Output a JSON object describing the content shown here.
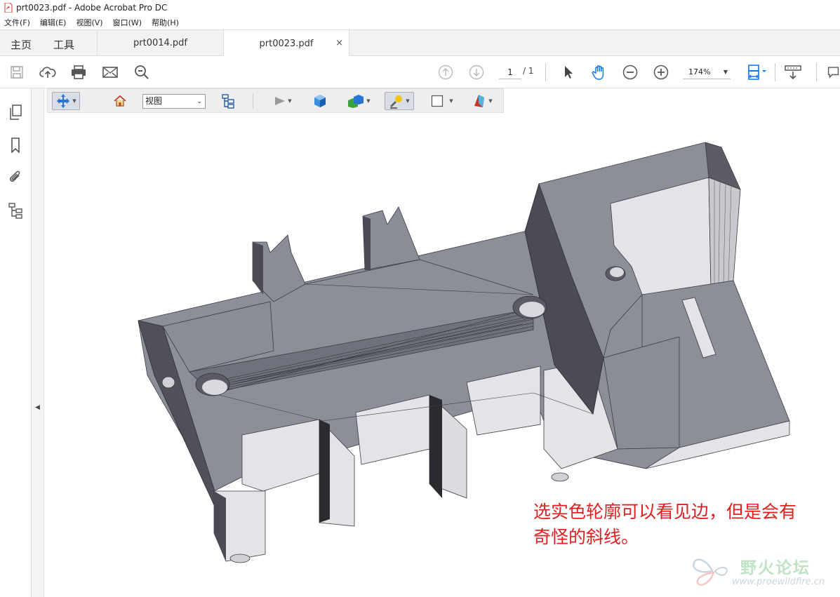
{
  "window": {
    "title": "prt0023.pdf - Adobe Acrobat Pro DC"
  },
  "menu": [
    "文件(F)",
    "编辑(E)",
    "视图(V)",
    "窗口(W)",
    "帮助(H)"
  ],
  "tabs": {
    "home": "主页",
    "tools": "工具",
    "doc1": "prt0014.pdf",
    "doc2": "prt0023.pdf",
    "close": "×"
  },
  "toolbar": {
    "page_current": "1",
    "page_total": "/ 1",
    "zoom": "174%"
  },
  "toolbar3d": {
    "view_select": "视图"
  },
  "annotation": {
    "line1": "选实色轮廓可以看见边，但是会有",
    "line2": "奇怪的斜线。"
  },
  "watermark": {
    "title": "野火论坛",
    "url": "www.proewildfire.cn"
  },
  "colors": {
    "annotation": "#e02020",
    "model_face": "#8c8e98",
    "model_light": "#e4e4e8",
    "model_dark": "#4a4b55"
  },
  "icons": [
    "save-icon",
    "upload-icon",
    "print-icon",
    "mail-icon",
    "search-icon",
    "page-up-icon",
    "page-down-icon",
    "select-icon",
    "hand-icon",
    "zoom-out-icon",
    "zoom-in-icon",
    "fit-page-icon",
    "scroll-mode-icon",
    "comment-icon",
    "pages-icon",
    "bookmark-icon",
    "attachment-icon",
    "tree-icon",
    "rotate-3d-icon",
    "home-view-icon",
    "model-tree-icon",
    "play-icon",
    "render-mode-icon",
    "lighting-icon",
    "background-icon",
    "cross-section-icon"
  ]
}
